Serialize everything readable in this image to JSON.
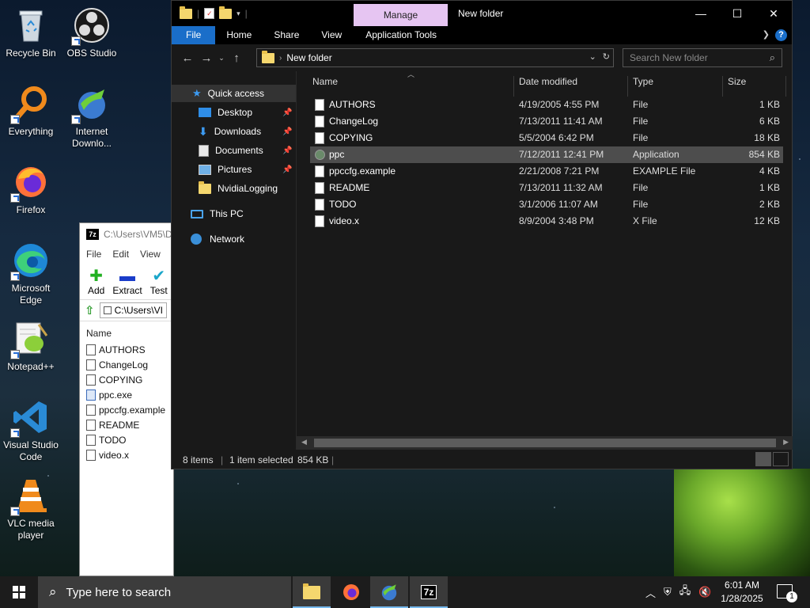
{
  "desktop": {
    "icons": [
      {
        "label": "Recycle Bin"
      },
      {
        "label": "OBS Studio"
      },
      {
        "label": "Everything"
      },
      {
        "label": "Internet Downlo..."
      },
      {
        "label": "Firefox"
      },
      {
        "label": "Microsoft Edge"
      },
      {
        "label": "Notepad++"
      },
      {
        "label": "Visual Studio Code"
      },
      {
        "label": "VLC media player"
      }
    ]
  },
  "zip_window": {
    "title": "C:\\Users\\VM5\\D",
    "logo": "7z",
    "menu": [
      "File",
      "Edit",
      "View"
    ],
    "tools": [
      "Add",
      "Extract",
      "Test"
    ],
    "address": "C:\\Users\\VI",
    "column": "Name",
    "files": [
      "AUTHORS",
      "ChangeLog",
      "COPYING",
      "ppc.exe",
      "ppccfg.example",
      "README",
      "TODO",
      "video.x"
    ]
  },
  "explorer": {
    "title": "New folder",
    "manage_tab": "Manage",
    "ribbon_tabs": [
      "File",
      "Home",
      "Share",
      "View",
      "Application Tools"
    ],
    "address": "New folder",
    "search_placeholder": "Search New folder",
    "nav": {
      "quick_access": "Quick access",
      "desktop": "Desktop",
      "downloads": "Downloads",
      "documents": "Documents",
      "pictures": "Pictures",
      "nvidia": "NvidiaLogging",
      "this_pc": "This PC",
      "network": "Network"
    },
    "columns": {
      "name": "Name",
      "date": "Date modified",
      "type": "Type",
      "size": "Size"
    },
    "files": [
      {
        "name": "AUTHORS",
        "date": "4/19/2005 4:55 PM",
        "type": "File",
        "size": "1 KB"
      },
      {
        "name": "ChangeLog",
        "date": "7/13/2011 11:41 AM",
        "type": "File",
        "size": "6 KB"
      },
      {
        "name": "COPYING",
        "date": "5/5/2004 6:42 PM",
        "type": "File",
        "size": "18 KB"
      },
      {
        "name": "ppc",
        "date": "7/12/2011 12:41 PM",
        "type": "Application",
        "size": "854 KB"
      },
      {
        "name": "ppccfg.example",
        "date": "2/21/2008 7:21 PM",
        "type": "EXAMPLE File",
        "size": "4 KB"
      },
      {
        "name": "README",
        "date": "7/13/2011 11:32 AM",
        "type": "File",
        "size": "1 KB"
      },
      {
        "name": "TODO",
        "date": "3/1/2006 11:07 AM",
        "type": "File",
        "size": "2 KB"
      },
      {
        "name": "video.x",
        "date": "8/9/2004 3:48 PM",
        "type": "X File",
        "size": "12 KB"
      }
    ],
    "selected_index": 3,
    "status": {
      "items": "8 items",
      "selected": "1 item selected",
      "size": "854 KB"
    }
  },
  "taskbar": {
    "search_placeholder": "Type here to search",
    "time": "6:01 AM",
    "date": "1/28/2025",
    "notifications": "1"
  },
  "colors": {
    "accent": "#1a6ec9",
    "manage": "#e6c5f2",
    "taskbar": "#1c1c1c"
  }
}
